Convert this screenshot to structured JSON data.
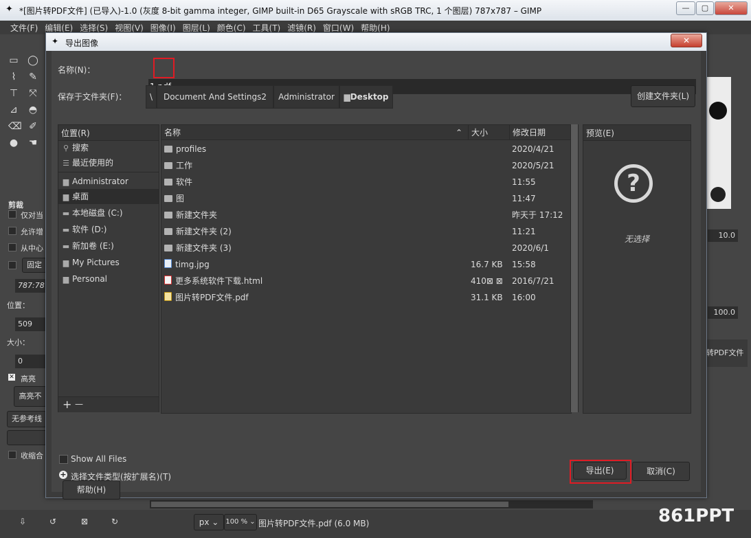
{
  "window": {
    "title": "*[图片转PDF文件] (已导入)-1.0 (灰度 8-bit gamma integer, GIMP built-in D65 Grayscale with sRGB TRC, 1 个图层) 787x787 – GIMP"
  },
  "menu": [
    "文件(F)",
    "编辑(E)",
    "选择(S)",
    "视图(V)",
    "图像(I)",
    "图层(L)",
    "颜色(C)",
    "工具(T)",
    "滤镜(R)",
    "窗口(W)",
    "帮助(H)"
  ],
  "dialog": {
    "title": "导出图像",
    "name_label": "名称(N)：",
    "name_value": "1.pdf",
    "save_in_label": "保存于文件夹(F)：",
    "path": [
      "\\",
      "Document And Settings2",
      "Administrator",
      "Desktop"
    ],
    "create_folder": "创建文件夹(L)",
    "places_header": "位置(R)",
    "places": [
      {
        "label": "搜索",
        "icon": "search-icon"
      },
      {
        "label": "最近使用的",
        "icon": "recent-icon"
      },
      {
        "label": "Administrator",
        "icon": "folder-icon"
      },
      {
        "label": "桌面",
        "icon": "folder-icon"
      },
      {
        "label": "本地磁盘 (C:)",
        "icon": "drive-icon"
      },
      {
        "label": "软件 (D:)",
        "icon": "drive-icon"
      },
      {
        "label": "新加卷 (E:)",
        "icon": "drive-icon"
      },
      {
        "label": "My Pictures",
        "icon": "folder-icon"
      },
      {
        "label": "Personal",
        "icon": "folder-icon"
      }
    ],
    "places_add": "+",
    "places_remove": "—",
    "columns": {
      "name": "名称",
      "size": "大小",
      "modified": "修改日期"
    },
    "files": [
      {
        "name": "profiles",
        "size": "",
        "modified": "2020/4/21",
        "icon": "folder-icon"
      },
      {
        "name": "工作",
        "size": "",
        "modified": "2020/5/21",
        "icon": "folder-icon"
      },
      {
        "name": "软件",
        "size": "",
        "modified": "11:55",
        "icon": "folder-icon"
      },
      {
        "name": "图",
        "size": "",
        "modified": "11:47",
        "icon": "folder-icon"
      },
      {
        "name": "新建文件夹",
        "size": "",
        "modified": "昨天于 17:12",
        "icon": "folder-icon"
      },
      {
        "name": "新建文件夹 (2)",
        "size": "",
        "modified": "11:21",
        "icon": "folder-icon"
      },
      {
        "name": "新建文件夹 (3)",
        "size": "",
        "modified": "2020/6/1",
        "icon": "folder-icon"
      },
      {
        "name": "timg.jpg",
        "size": "16.7 KB",
        "modified": "15:58",
        "icon": "image-file-icon"
      },
      {
        "name": "更多系统软件下载.html",
        "size": "410⊠ ⊠",
        "modified": "2016/7/21",
        "icon": "html-file-icon"
      },
      {
        "name": "图片转PDF文件.pdf",
        "size": "31.1 KB",
        "modified": "16:00",
        "icon": "pdf-file-icon"
      }
    ],
    "preview_header": "预览(E)",
    "preview_empty": "无选择",
    "show_all_files": "Show All Files",
    "file_type_toggle": "选择文件类型(按扩展名)(T)",
    "help_button": "帮助(H)",
    "export_button": "导出(E)",
    "cancel_button": "取消(C)"
  },
  "toolbox": {
    "crop_title": "剪裁",
    "opt_current_layer": "仅对当",
    "opt_allow_grow": "允许增",
    "opt_from_center": "从中心",
    "fixed_label": "固定",
    "ratio_value": "787:78",
    "position_label": "位置：",
    "position_value": "509",
    "size_label": "大小：",
    "size_value": "0",
    "highlight_label": "高亮",
    "highlight_combo": "高亮不",
    "guides_combo": "无参考线",
    "shrink_label": "收缩合"
  },
  "rightdock": {
    "spacing_value": "10.0",
    "opacity_value": "100.0",
    "layer_name": "转PDF文件"
  },
  "statusbar": {
    "unit": "px",
    "zoom": "100 %",
    "file_info": "图片转PDF文件.pdf (6.0 MB)",
    "watermark": "861PPT"
  }
}
